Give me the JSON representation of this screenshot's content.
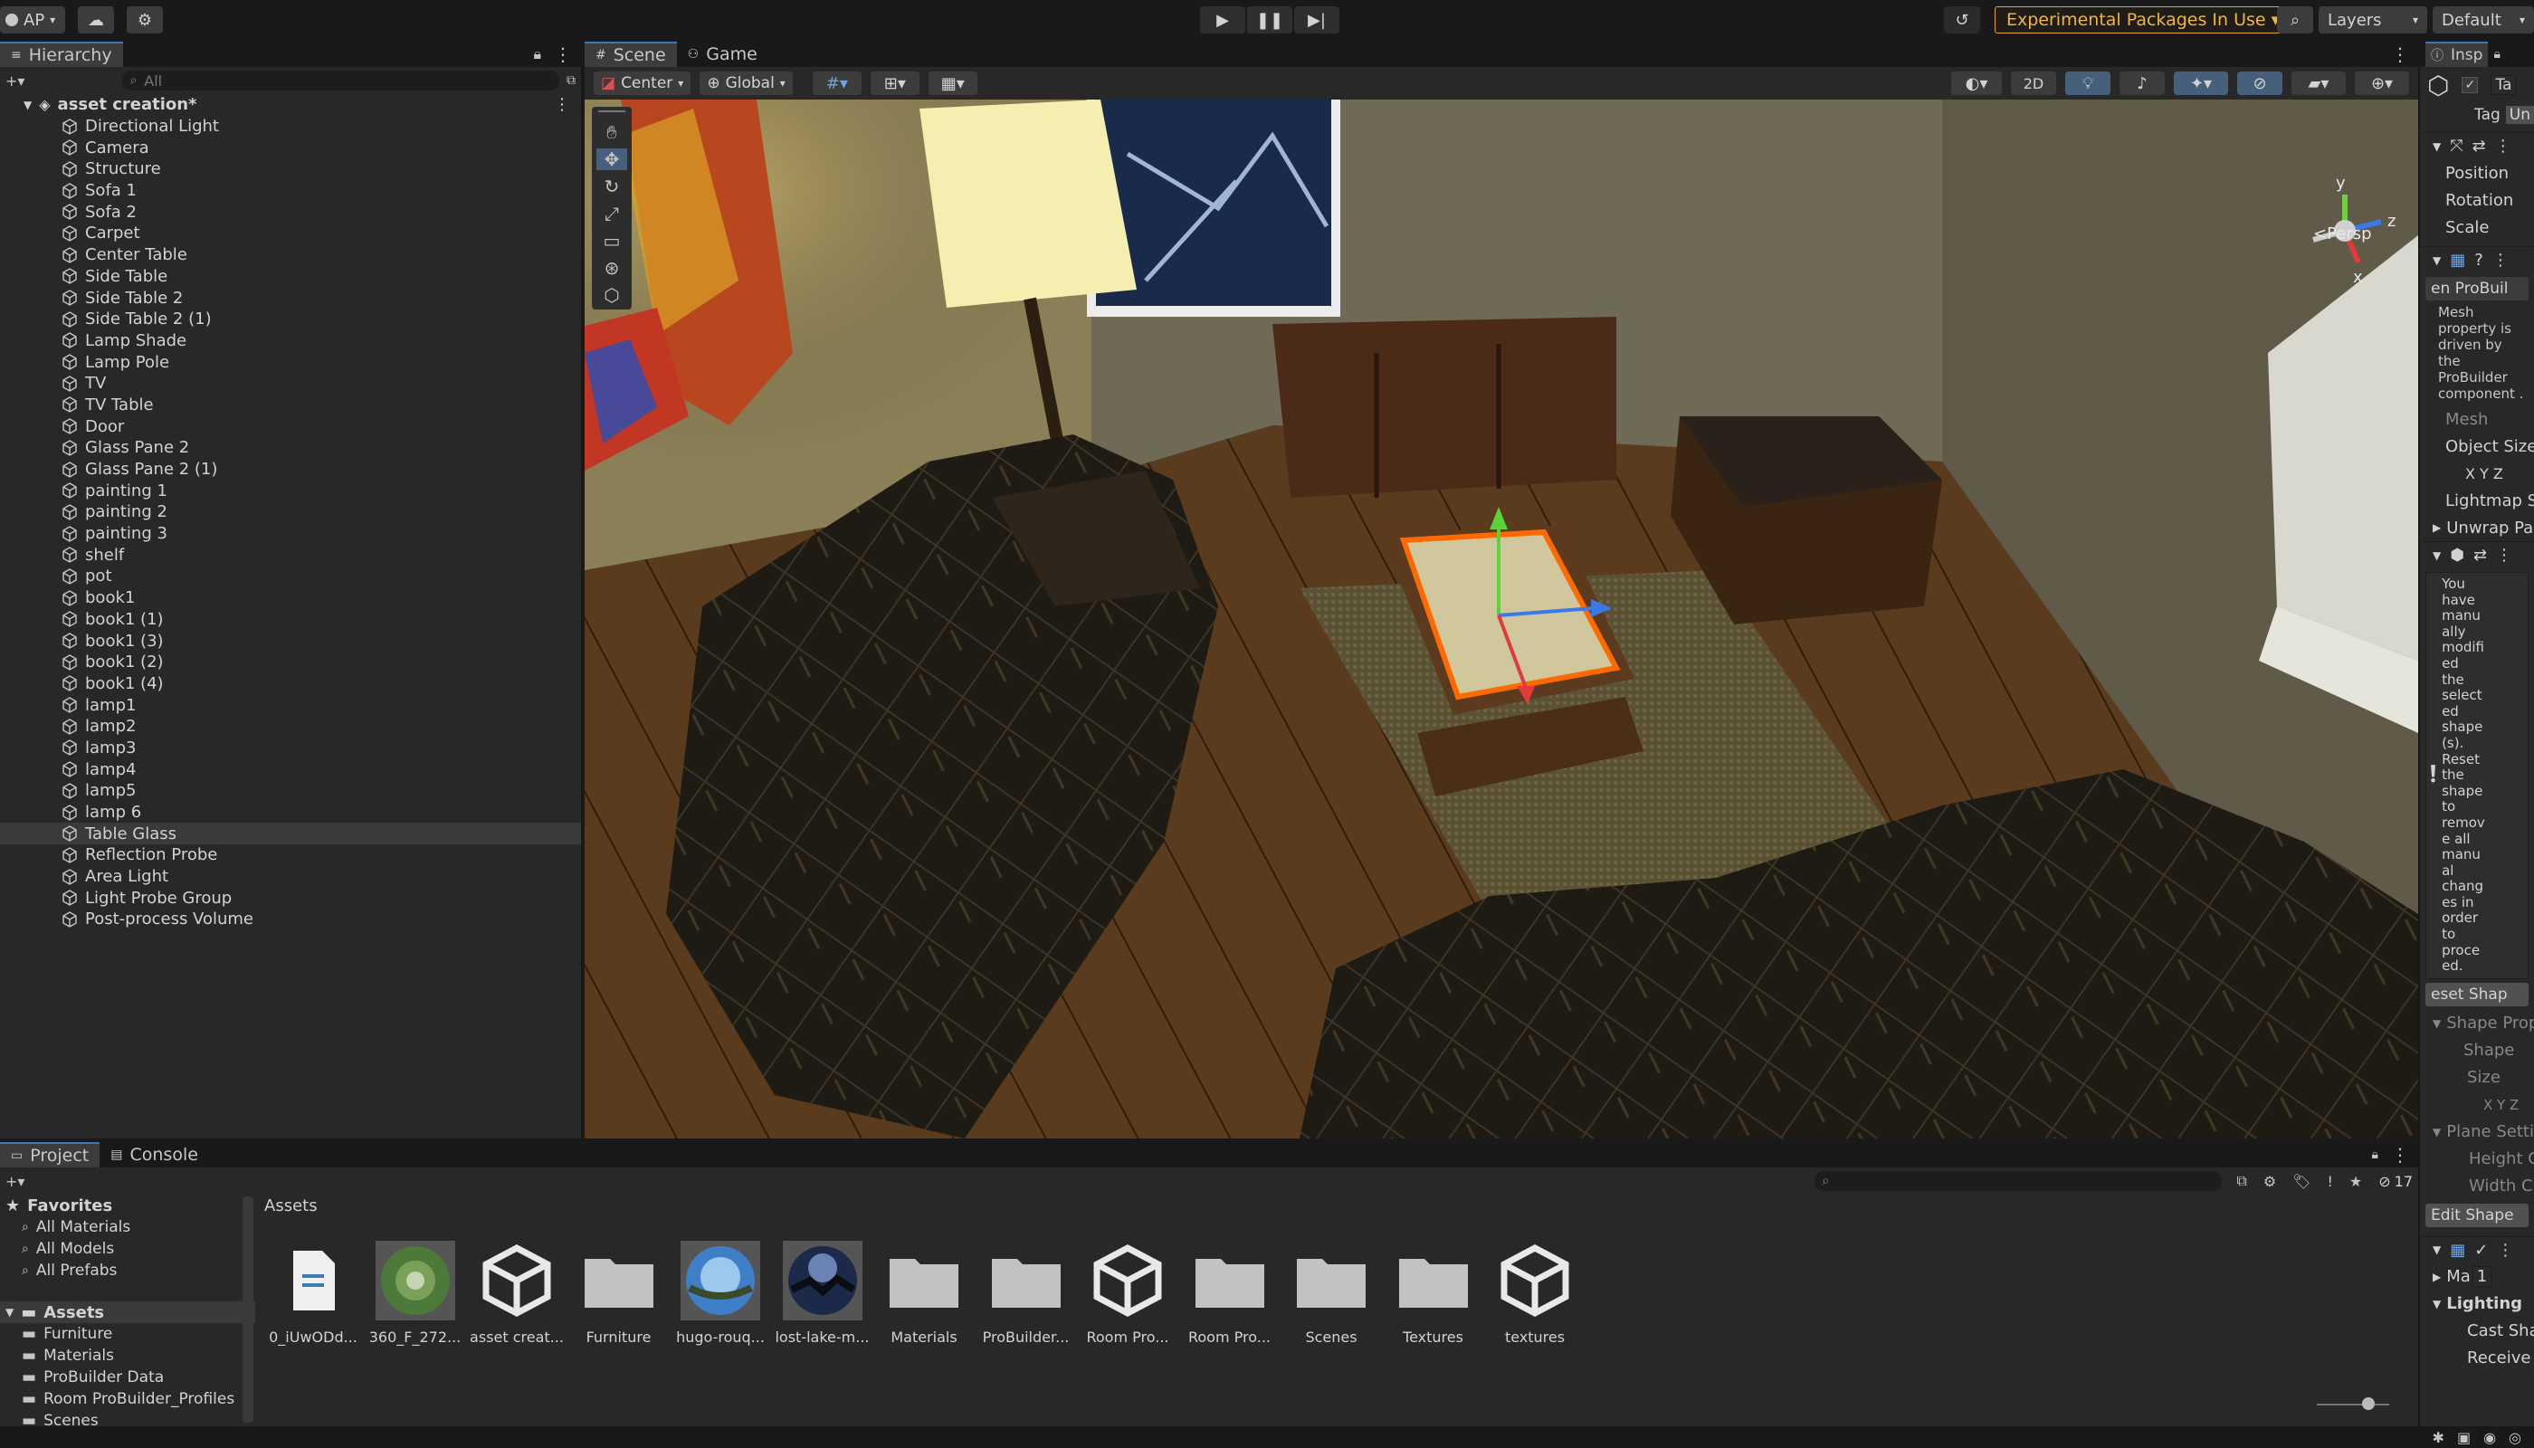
{
  "toolbar": {
    "account": "AP",
    "experimental": "Experimental Packages In Use ▾",
    "layers": "Layers",
    "layout": "Default"
  },
  "hierarchy": {
    "tab": "Hierarchy",
    "search_placeholder": "All",
    "scene_name": "asset creation*",
    "items": [
      "Directional Light",
      "Camera",
      "Structure",
      "Sofa 1",
      "Sofa 2",
      "Carpet",
      "Center Table",
      "Side Table",
      "Side Table 2",
      "Side Table 2 (1)",
      "Lamp Shade",
      "Lamp Pole",
      "TV",
      "TV Table",
      "Door",
      "Glass Pane 2",
      "Glass Pane 2 (1)",
      "painting 1",
      "painting 2",
      "painting 3",
      "shelf",
      "pot",
      "book1",
      "book1 (1)",
      "book1 (3)",
      "book1 (2)",
      "book1 (4)",
      "lamp1",
      "lamp2",
      "lamp3",
      "lamp4",
      "lamp5",
      "lamp 6",
      "Table Glass",
      "Reflection Probe",
      "Area Light",
      "Light Probe Group",
      "Post-process Volume"
    ],
    "selected_index": 33
  },
  "scene": {
    "tab_scene": "Scene",
    "tab_game": "Game",
    "pivot": "Center",
    "space": "Global",
    "mode_2d": "2D",
    "persp": "<Persp",
    "gizmo_axes": {
      "y": "y",
      "z": "z",
      "x": "x"
    }
  },
  "inspector": {
    "tab": "Insp",
    "tag_label": "Tag",
    "tag_value": "Un",
    "position": "Position",
    "rotation": "Rotation",
    "scale": "Scale",
    "probuilder_btn": "en ProBuil",
    "mesh_note": "Mesh property is driven by the ProBuilder component .",
    "mesh_label": "Mesh",
    "object_size": "Object Size",
    "xyz": "X  Y  Z",
    "lightmap": "Lightmap St",
    "unwrap": "Unwrap Par",
    "warning": "You have manu ally modifi ed the select ed shape (s). Reset the shape to remov e all manu al chang es in order to proce ed.",
    "reset_shape": "eset Shap",
    "shape_props": "Shape Prop",
    "shape": "Shape",
    "size": "Size",
    "xyz2": "X  Y  Z",
    "plane_settings": "Plane Settin",
    "height_cuts": "Height C",
    "width_cuts": "Width Cu",
    "edit_shape": "Edit Shape",
    "materials_label": "Ma",
    "materials_count": "1",
    "lighting": "Lighting",
    "cast_shadows": "Cast Sha",
    "receive": "Receive"
  },
  "project": {
    "tab_project": "Project",
    "tab_console": "Console",
    "favorites": "Favorites",
    "fav_items": [
      "All Materials",
      "All Models",
      "All Prefabs"
    ],
    "assets_root": "Assets",
    "folders": [
      "Furniture",
      "Materials",
      "ProBuilder Data",
      "Room ProBuilder_Profiles",
      "Scenes"
    ],
    "breadcrumb": "Assets",
    "hidden_count": "17",
    "assets": [
      {
        "name": "0_iUwODd...",
        "kind": "file"
      },
      {
        "name": "360_F_272...",
        "kind": "hdri-green"
      },
      {
        "name": "asset creat...",
        "kind": "unity"
      },
      {
        "name": "Furniture",
        "kind": "folder"
      },
      {
        "name": "hugo-rouq...",
        "kind": "hdri-blue"
      },
      {
        "name": "lost-lake-m...",
        "kind": "hdri-night"
      },
      {
        "name": "Materials",
        "kind": "folder"
      },
      {
        "name": "ProBuilder...",
        "kind": "folder"
      },
      {
        "name": "Room Pro...",
        "kind": "unity"
      },
      {
        "name": "Room Pro...",
        "kind": "folder"
      },
      {
        "name": "Scenes",
        "kind": "folder"
      },
      {
        "name": "Textures",
        "kind": "folder"
      },
      {
        "name": "textures",
        "kind": "unity"
      }
    ]
  },
  "colors": {
    "accent": "#3a79bb",
    "selection_outline": "#ff6a00",
    "warning": "#f2b43d"
  }
}
